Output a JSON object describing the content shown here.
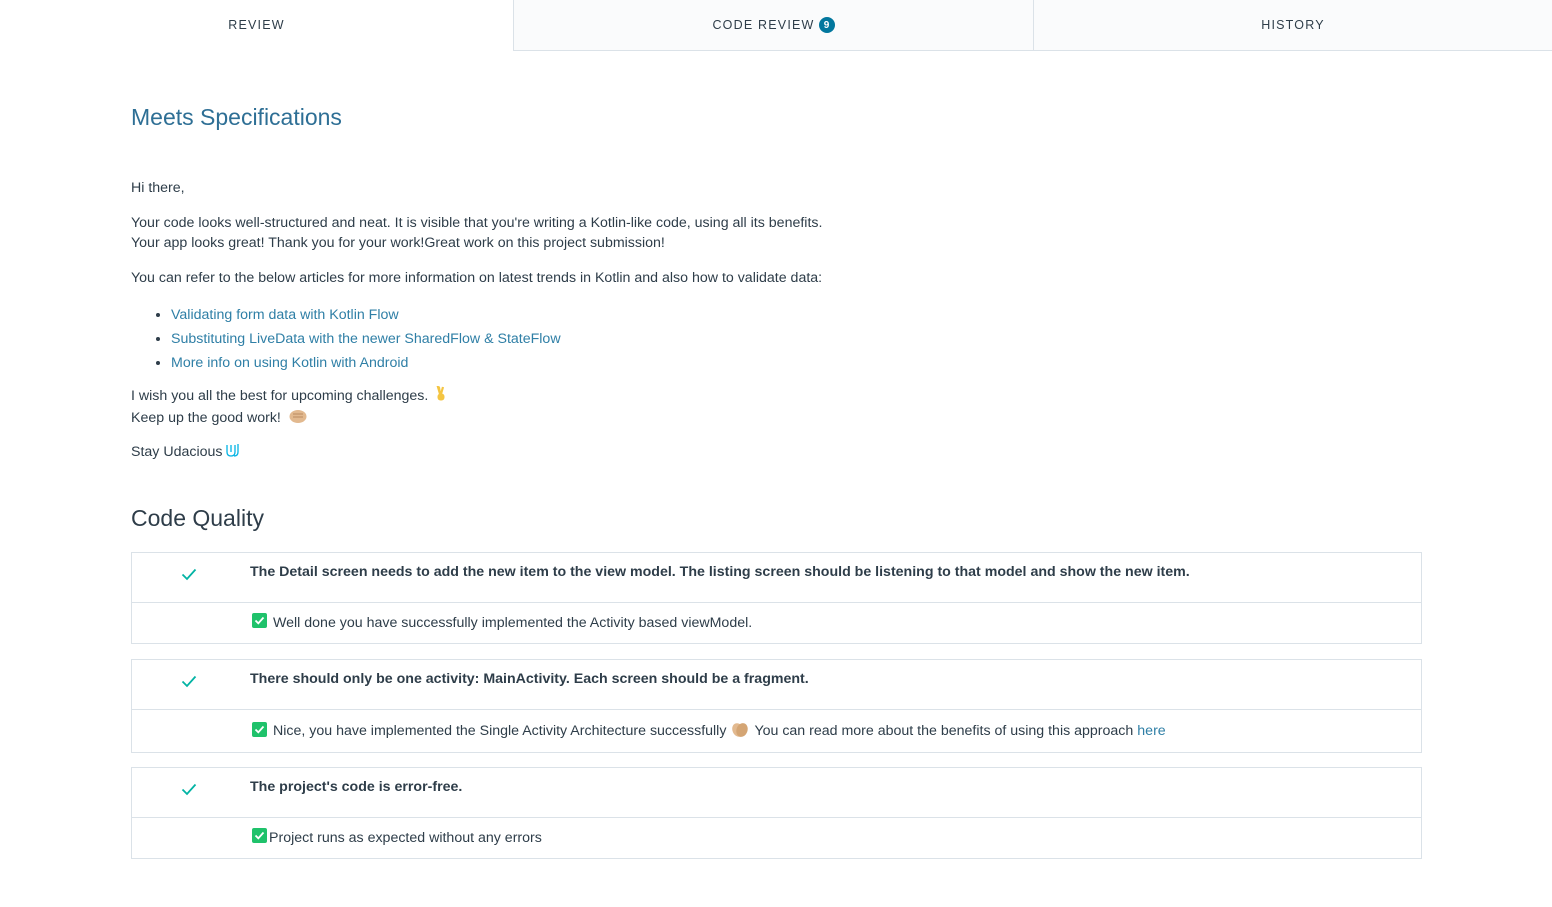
{
  "tabs": {
    "review": "REVIEW",
    "code_review": "CODE REVIEW",
    "code_review_count": "9",
    "history": "HISTORY"
  },
  "review": {
    "heading": "Meets Specifications",
    "greeting": "Hi there,",
    "code_line1": "Your code looks well-structured and neat. It is visible that you're writing a Kotlin-like code, using all its benefits.",
    "code_line2": "Your app looks great! Thank you for your work!Great work on this project submission!",
    "refer": "You can refer to the below articles for more information on latest trends in Kotlin and also how to validate data:",
    "links": [
      "Validating form data with Kotlin Flow",
      "Substituting LiveData with the newer SharedFlow & StateFlow",
      "More info on using Kotlin with Android"
    ],
    "wish": "I wish you all the best for upcoming challenges.",
    "keep_up": "Keep up the good work!",
    "stay": "Stay Udacious"
  },
  "code_quality": {
    "heading": "Code Quality",
    "criteria": [
      {
        "title": "The Detail screen needs to add the new item to the view model. The listing screen should be listening to that model and show the new item.",
        "note": "Well done you have successfully implemented the Activity based viewModel."
      },
      {
        "title": "There should only be one activity: MainActivity. Each screen should be a fragment.",
        "note": "Nice, you have implemented the Single Activity Architecture successfully",
        "note_after": "You can read more about the benefits of using this approach",
        "link": "here"
      },
      {
        "title": "The project's code is error-free.",
        "note": "Project runs as expected without any errors"
      }
    ]
  },
  "colors": {
    "accent": "#02779e",
    "link": "#2f7fa6",
    "check": "#02b3a4",
    "checkbox": "#1fc26b"
  }
}
